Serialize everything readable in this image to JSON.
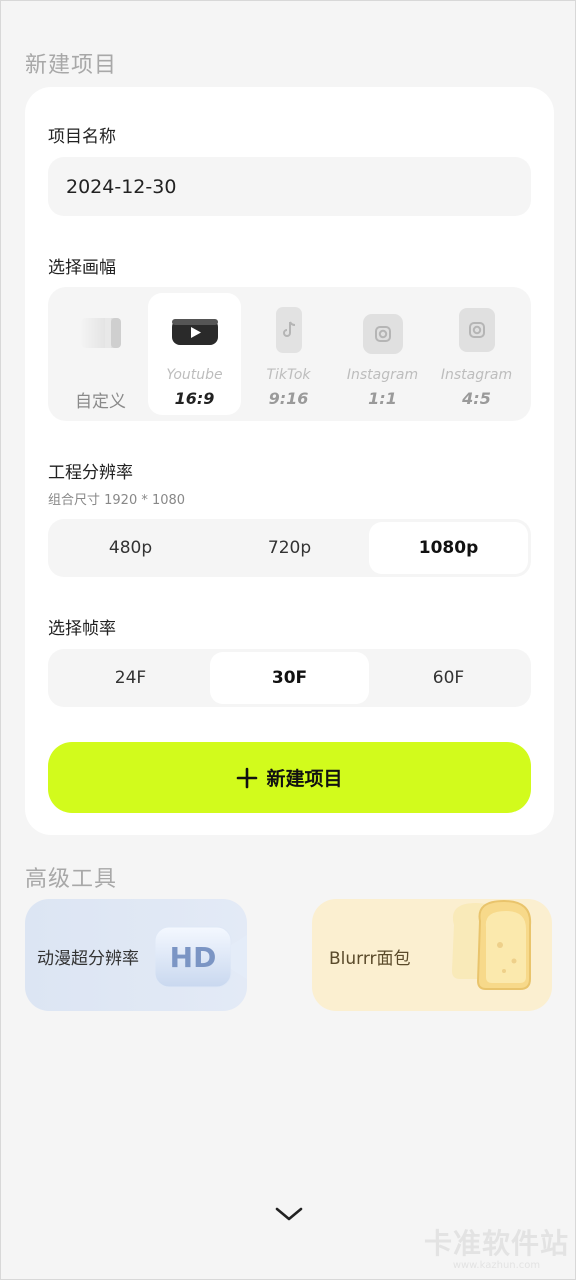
{
  "new_project": {
    "section_title": "新建项目",
    "name_label": "项目名称",
    "name_value": "2024-12-30",
    "canvas_label": "选择画幅",
    "canvas_options": [
      {
        "name": "",
        "value": "",
        "custom_label": "自定义",
        "icon": "custom-frame-icon"
      },
      {
        "name": "Youtube",
        "value": "16:9",
        "icon": "youtube-icon",
        "selected": true
      },
      {
        "name": "TikTok",
        "value": "9:16",
        "icon": "tiktok-icon"
      },
      {
        "name": "Instagram",
        "value": "1:1",
        "icon": "instagram-icon"
      },
      {
        "name": "Instagram",
        "value": "4:5",
        "icon": "instagram-icon"
      }
    ],
    "resolution_label": "工程分辨率",
    "resolution_sub": "组合尺寸 1920 * 1080",
    "resolutions": [
      "480p",
      "720p",
      "1080p"
    ],
    "resolution_selected": "1080p",
    "framerate_label": "选择帧率",
    "framerates": [
      "24F",
      "30F",
      "60F"
    ],
    "framerate_selected": "30F",
    "create_button": "新建项目",
    "accent_color": "#d2fb1c"
  },
  "advanced_tools": {
    "section_title": "高级工具",
    "items": [
      {
        "label": "动漫超分辨率",
        "badge": "HD",
        "icon": "hd-camera-icon"
      },
      {
        "label": "Blurrr面包",
        "icon": "bread-icon"
      }
    ]
  },
  "footer": {
    "chevron": "chevron-down-icon",
    "watermark_main": "卡准软件站",
    "watermark_sub": "www.kazhun.com"
  }
}
